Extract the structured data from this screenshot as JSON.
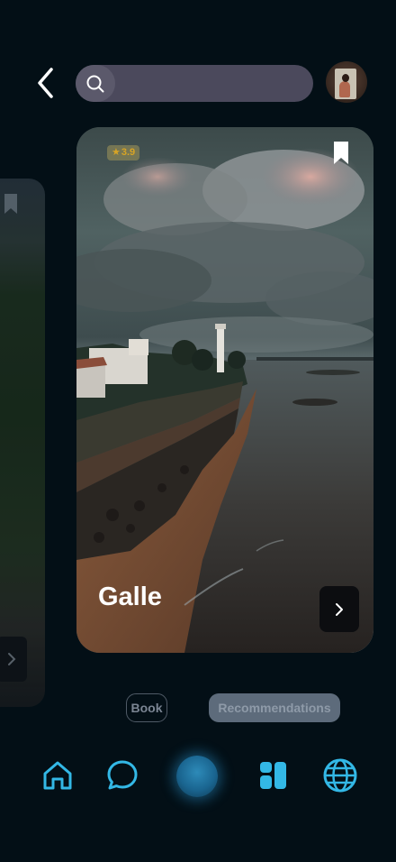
{
  "header": {
    "back_icon": "chevron-left-icon",
    "search": {
      "placeholder": "",
      "value": "",
      "icon": "search-icon"
    },
    "avatar_icon": "user-avatar"
  },
  "cards": {
    "previous": {
      "bookmark_icon": "bookmark-icon",
      "arrow_icon": "chevron-right-icon"
    },
    "current": {
      "rating_star": "★",
      "rating": "3.9",
      "title": "Galle",
      "bookmark_icon": "bookmark-icon",
      "next_icon": "chevron-right-icon"
    }
  },
  "actions": {
    "book_label": "Book",
    "recommendations_label": "Recommendations"
  },
  "bottom_nav": {
    "items": [
      "home-icon",
      "chat-icon",
      "assistant-orb",
      "dashboard-icon",
      "globe-icon"
    ]
  },
  "colors": {
    "background": "#030f16",
    "accent": "#33b8e6",
    "search_bg": "#4b495c",
    "rating_text": "#d7a425"
  }
}
